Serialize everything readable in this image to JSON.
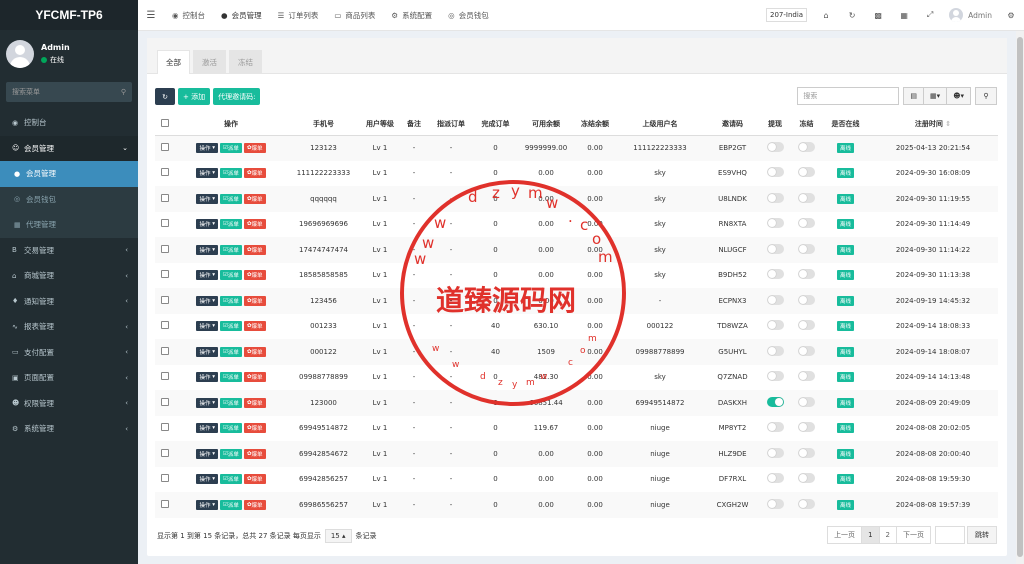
{
  "app": {
    "logo": "YFCMF-TP6"
  },
  "sidebar": {
    "user": {
      "name": "Admin",
      "status": "在线"
    },
    "search_placeholder": "搜索菜单",
    "items": [
      {
        "label": "控制台",
        "icon": "dashboard-icon"
      },
      {
        "label": "会员管理",
        "icon": "user-circle-icon"
      },
      {
        "label": "会员管理",
        "icon": "user-icon"
      },
      {
        "label": "会员钱包",
        "icon": "wallet-icon"
      },
      {
        "label": "代理管理",
        "icon": "sitemap-icon"
      },
      {
        "label": "交易管理",
        "icon": "bitcoin-icon"
      },
      {
        "label": "商城管理",
        "icon": "home-icon"
      },
      {
        "label": "通知管理",
        "icon": "bell-icon"
      },
      {
        "label": "报表管理",
        "icon": "chart-icon"
      },
      {
        "label": "支付配置",
        "icon": "card-icon"
      },
      {
        "label": "页面配置",
        "icon": "file-icon"
      },
      {
        "label": "权限管理",
        "icon": "users-icon"
      },
      {
        "label": "系统管理",
        "icon": "gears-icon"
      }
    ]
  },
  "header": {
    "tabs": [
      {
        "label": "控制台",
        "icon": "dashboard-icon"
      },
      {
        "label": "会员管理",
        "icon": "user-icon"
      },
      {
        "label": "订单列表",
        "icon": "list-icon"
      },
      {
        "label": "商品列表",
        "icon": "desktop-icon"
      },
      {
        "label": "系统配置",
        "icon": "gear-icon"
      },
      {
        "label": "会员钱包",
        "icon": "wallet-icon"
      }
    ],
    "lang": "207-India",
    "user": "Admin"
  },
  "content": {
    "tabs": [
      "全部",
      "激活",
      "冻结"
    ],
    "toolbar": {
      "add": "添加",
      "invite": "代理邀请码:"
    },
    "search_placeholder": "搜索",
    "columns": [
      "操作",
      "手机号",
      "用户等级",
      "备注",
      "指派订单",
      "完成订单",
      "可用余额",
      "冻结余额",
      "上级用户名",
      "邀请码",
      "提现",
      "冻结",
      "是否在线",
      "注册时间"
    ],
    "op_labels": {
      "menu": "操作",
      "assign": "派单",
      "robbed": "爆单"
    },
    "online_label": "离线",
    "rows": [
      {
        "phone": "123123",
        "level": "Lv 1",
        "note": "-",
        "assign": "-",
        "done": "0",
        "balance": "9999999.00",
        "frozen": "0.00",
        "parent": "111122223333",
        "code": "EBP2GT",
        "withdraw": false,
        "freeze": false,
        "time": "2025-04-13 20:21:54"
      },
      {
        "phone": "111122223333",
        "level": "Lv 1",
        "note": "-",
        "assign": "-",
        "done": "0",
        "balance": "0.00",
        "frozen": "0.00",
        "parent": "sky",
        "code": "ES9VHQ",
        "withdraw": false,
        "freeze": false,
        "time": "2024-09-30 16:08:09"
      },
      {
        "phone": "qqqqqq",
        "level": "Lv 1",
        "note": "-",
        "assign": "-",
        "done": "0",
        "balance": "0.00",
        "frozen": "0.00",
        "parent": "sky",
        "code": "U8LNDK",
        "withdraw": false,
        "freeze": false,
        "time": "2024-09-30 11:19:55"
      },
      {
        "phone": "19696969696",
        "level": "Lv 1",
        "note": "-",
        "assign": "-",
        "done": "0",
        "balance": "0.00",
        "frozen": "0.00",
        "parent": "sky",
        "code": "RN8XTA",
        "withdraw": false,
        "freeze": false,
        "time": "2024-09-30 11:14:49"
      },
      {
        "phone": "17474747474",
        "level": "Lv 1",
        "note": "-",
        "assign": "-",
        "done": "0",
        "balance": "0.00",
        "frozen": "0.00",
        "parent": "sky",
        "code": "NLUGCF",
        "withdraw": false,
        "freeze": false,
        "time": "2024-09-30 11:14:22"
      },
      {
        "phone": "18585858585",
        "level": "Lv 1",
        "note": "-",
        "assign": "-",
        "done": "0",
        "balance": "0.00",
        "frozen": "0.00",
        "parent": "sky",
        "code": "B9DH52",
        "withdraw": false,
        "freeze": false,
        "time": "2024-09-30 11:13:38"
      },
      {
        "phone": "123456",
        "level": "Lv 1",
        "note": "-",
        "assign": "-",
        "done": "0",
        "balance": "0.00",
        "frozen": "0.00",
        "parent": "-",
        "code": "ECPNX3",
        "withdraw": false,
        "freeze": false,
        "time": "2024-09-19 14:45:32"
      },
      {
        "phone": "001233",
        "level": "Lv 1",
        "note": "-",
        "assign": "-",
        "done": "40",
        "balance": "630.10",
        "frozen": "0.00",
        "parent": "000122",
        "code": "TD8WZA",
        "withdraw": false,
        "freeze": false,
        "time": "2024-09-14 18:08:33"
      },
      {
        "phone": "000122",
        "level": "Lv 1",
        "note": "-",
        "assign": "-",
        "done": "40",
        "balance": "1509",
        "frozen": "0.00",
        "parent": "09988778899",
        "code": "G5UHYL",
        "withdraw": false,
        "freeze": false,
        "time": "2024-09-14 18:08:07"
      },
      {
        "phone": "09988778899",
        "level": "Lv 1",
        "note": "-",
        "assign": "-",
        "done": "0",
        "balance": "482.30",
        "frozen": "0.00",
        "parent": "sky",
        "code": "Q7ZNAD",
        "withdraw": false,
        "freeze": false,
        "time": "2024-09-14 14:13:48"
      },
      {
        "phone": "123000",
        "level": "Lv 1",
        "note": "-",
        "assign": "-",
        "done": "8",
        "balance": "66851.44",
        "frozen": "0.00",
        "parent": "69949514872",
        "code": "DASKXH",
        "withdraw": true,
        "freeze": false,
        "time": "2024-08-09 20:49:09"
      },
      {
        "phone": "69949514872",
        "level": "Lv 1",
        "note": "-",
        "assign": "-",
        "done": "0",
        "balance": "119.67",
        "frozen": "0.00",
        "parent": "niuge",
        "code": "MP8YT2",
        "withdraw": false,
        "freeze": false,
        "time": "2024-08-08 20:02:05"
      },
      {
        "phone": "69942854672",
        "level": "Lv 1",
        "note": "-",
        "assign": "-",
        "done": "0",
        "balance": "0.00",
        "frozen": "0.00",
        "parent": "niuge",
        "code": "HLZ9DE",
        "withdraw": false,
        "freeze": false,
        "time": "2024-08-08 20:00:40"
      },
      {
        "phone": "69942856257",
        "level": "Lv 1",
        "note": "-",
        "assign": "-",
        "done": "0",
        "balance": "0.00",
        "frozen": "0.00",
        "parent": "niuge",
        "code": "DF7RXL",
        "withdraw": false,
        "freeze": false,
        "time": "2024-08-08 19:59:30"
      },
      {
        "phone": "69986556257",
        "level": "Lv 1",
        "note": "-",
        "assign": "-",
        "done": "0",
        "balance": "0.00",
        "frozen": "0.00",
        "parent": "niuge",
        "code": "CXGH2W",
        "withdraw": false,
        "freeze": false,
        "time": "2024-08-08 19:57:39"
      }
    ],
    "footer": {
      "info": "显示第 1 到第 15 条记录，总共 27 条记录 每页显示",
      "page_size": "15",
      "suffix": "条记录"
    },
    "pager": {
      "prev": "上一页",
      "pages": [
        "1",
        "2"
      ],
      "next": "下一页",
      "go": "跳转"
    }
  },
  "watermark": {
    "text": "道臻源码网",
    "letters": [
      "d",
      "z",
      "y",
      "m",
      "w",
      ".",
      "c",
      "o",
      "m"
    ]
  }
}
